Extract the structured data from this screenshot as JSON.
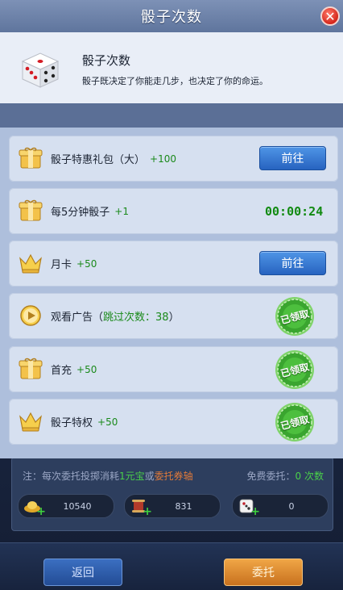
{
  "dialog": {
    "title": "骰子次数",
    "close_icon": "close-icon",
    "header": {
      "title": "骰子次数",
      "description": "骰子既决定了你能走几步，也决定了你的命运。",
      "icon": "dice-icon"
    },
    "rows": [
      {
        "icon": "gift-box-icon",
        "label": "骰子特惠礼包（大）",
        "bonus": "+100",
        "action": "button",
        "action_label": "前往"
      },
      {
        "icon": "gift-box-icon",
        "label": "每5分钟骰子",
        "bonus": "+1",
        "action": "timer",
        "timer": "00:00:24"
      },
      {
        "icon": "crown-icon",
        "label": "月卡",
        "bonus": "+50",
        "action": "button",
        "action_label": "前往"
      },
      {
        "icon": "play-icon",
        "label_prefix": "观看广告（",
        "label_highlight": "跳过次数：38",
        "label_suffix": "）",
        "action": "claimed",
        "action_label": "已领取"
      },
      {
        "icon": "gift-box-icon",
        "label": "首充",
        "bonus": "+50",
        "action": "claimed",
        "action_label": "已领取"
      },
      {
        "icon": "crown-icon",
        "label": "骰子特权",
        "bonus": "+50",
        "action": "claimed",
        "action_label": "已领取"
      }
    ]
  },
  "background": {
    "note": {
      "prefix": "注：每次委托投掷消耗",
      "green": "1元宝",
      "middle": "或",
      "orange": "委托券轴",
      "right_label": "免费委托：",
      "right_value": "0 次数"
    },
    "resources": [
      {
        "icon": "gold-ingot-icon",
        "value": "10540"
      },
      {
        "icon": "scroll-icon",
        "value": "831"
      },
      {
        "icon": "dice-icon",
        "value": "0"
      }
    ],
    "buttons": {
      "back": "返回",
      "entrust": "委托"
    }
  },
  "colors": {
    "accent_blue": "#2763c0",
    "timer_green": "#118a11",
    "bonus_green": "#1b8a1b",
    "close_red": "#d4261b",
    "claimed_green": "#3aa52f"
  }
}
